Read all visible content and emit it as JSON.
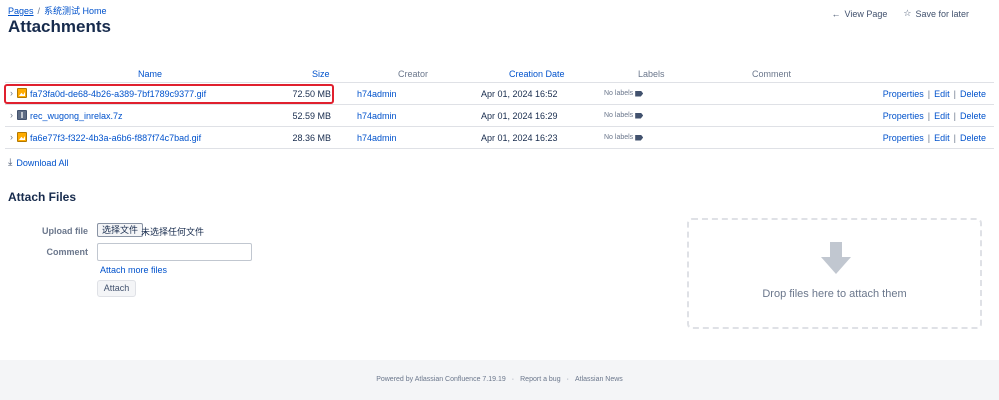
{
  "breadcrumb": {
    "pages": "Pages",
    "separator": "/",
    "space_home": "系统测试 Home"
  },
  "page_title": "Attachments",
  "top_actions": {
    "view_page": "View Page",
    "save_for_later": "Save for later"
  },
  "table": {
    "headers": {
      "name": "Name",
      "size": "Size",
      "creator": "Creator",
      "creation_date": "Creation Date",
      "labels": "Labels",
      "comment": "Comment"
    },
    "rows": [
      {
        "name": "fa73fa0d-de68-4b26-a389-7bf1789c9377.gif",
        "type": "gif",
        "size": "72.50 MB",
        "creator": "h74admin",
        "date": "Apr 01, 2024 16:52",
        "labels": "No labels",
        "highlighted": true
      },
      {
        "name": "rec_wugong_inrelax.7z",
        "type": "zip",
        "size": "52.59 MB",
        "creator": "h74admin",
        "date": "Apr 01, 2024 16:29",
        "labels": "No labels",
        "highlighted": false
      },
      {
        "name": "fa6e77f3-f322-4b3a-a6b6-f887f74c7bad.gif",
        "type": "gif",
        "size": "28.36 MB",
        "creator": "h74admin",
        "date": "Apr 01, 2024 16:23",
        "labels": "No labels",
        "highlighted": false
      }
    ],
    "row_actions": {
      "properties": "Properties",
      "edit": "Edit",
      "delete": "Delete",
      "separator": "|"
    }
  },
  "download_all": "Download All",
  "attach_section": {
    "title": "Attach Files",
    "upload_label": "Upload file",
    "choose_button": "选择文件",
    "no_file": "未选择任何文件",
    "comment_label": "Comment",
    "attach_more": "Attach more files",
    "attach_button": "Attach",
    "drop_text": "Drop files here to attach them"
  },
  "footer": {
    "powered": "Powered by Atlassian Confluence 7.19.19",
    "bug": "Report a bug",
    "news": "Atlassian News",
    "separator": "·"
  },
  "colors": {
    "link": "#0052cc",
    "highlight": "#e0202e",
    "text": "#172b4d",
    "muted": "#6b778c"
  },
  "icons": [
    "chevron-left-icon",
    "star-icon",
    "chevron-right-icon",
    "gif-file-icon",
    "archive-file-icon",
    "tag-icon",
    "download-icon",
    "drop-arrow-icon"
  ]
}
